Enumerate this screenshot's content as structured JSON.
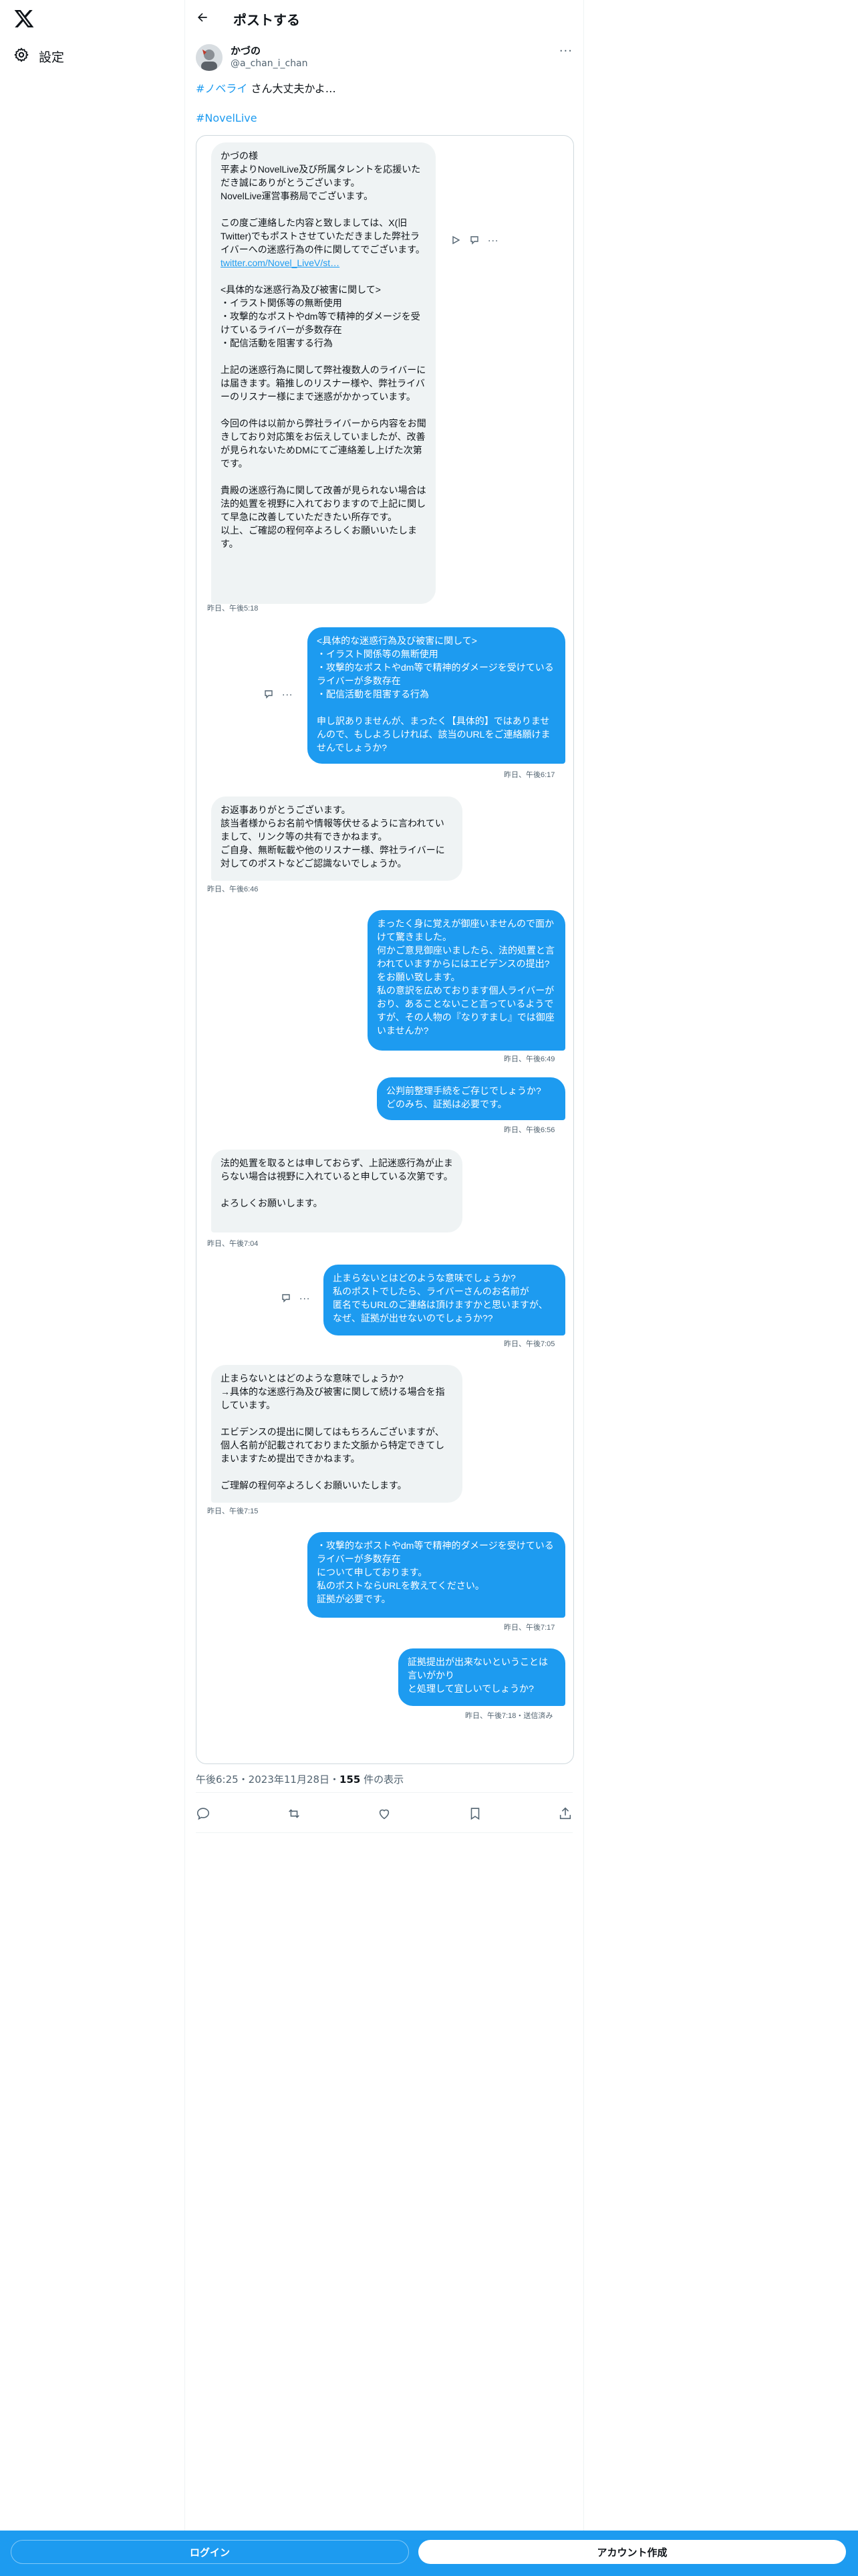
{
  "nav": {
    "settings_label": "設定"
  },
  "header": {
    "title": "ポストする"
  },
  "author": {
    "name": "かづの",
    "handle": "@a_chan_i_chan"
  },
  "tweet": {
    "hashtag1": "#ノベライ",
    "text_after_hashtag": " さん大丈夫かよ…",
    "hashtag2": "#NovelLive"
  },
  "dm": {
    "m1": "かづの様\n平素よりNovelLive及び所属タレントを応援いただき誠にありがとうございます。\nNovelLive運営事務局でございます。\n\nこの度ご連絡した内容と致しましては、X(旧Twitter)でもポストさせていただきました弊社ライバーへの迷惑行為の件に関してでございます。",
    "m1_link": "twitter.com/Novel_LiveV/st…",
    "m1_rest": "\n<具体的な迷惑行為及び被害に関して>\n・イラスト関係等の無断使用\n・攻撃的なポストやdm等で精神的ダメージを受けているライバーが多数存在\n・配信活動を阻害する行為\n\n上記の迷惑行為に関して弊社複数人のライバーには届きます。箱推しのリスナー様や、弊社ライバーのリスナー様にまで迷惑がかかっています。\n\n今回の件は以前から弊社ライバーから内容をお聞きしており対応策をお伝えしていましたが、改善が見られないためDMにてご連絡差し上げた次第です。\n\n貴殿の迷惑行為に関して改善が見られない場合は法的処置を視野に入れておりますので上記に関して早急に改善していただきたい所存です。\n以上、ご確認の程何卒よろしくお願いいたします。",
    "t1": "昨日、午後5:18",
    "m2": "<具体的な迷惑行為及び被害に関して>\n・イラスト関係等の無断使用\n・攻撃的なポストやdm等で精神的ダメージを受けているライバーが多数存在\n・配信活動を阻害する行為\n\n申し訳ありませんが、まったく【具体的】ではありませんので、もしよろしければ、該当のURLをご連絡願けませんでしょうか?",
    "t2": "昨日、午後6:17",
    "m3": "お返事ありがとうございます。\n該当者様からお名前や情報等伏せるように言われていまして、リンク等の共有できかねます。\nご自身、無断転載や他のリスナー様、弊社ライバーに対してのポストなどご認識ないでしょうか。",
    "t3": "昨日、午後6:46",
    "m4": "まったく身に覚えが御座いませんので面かけて驚きました。\n何かご意見御座いましたら、法的処置と言われていますからにはエビデンスの提出?をお願い致します。\n私の意訳を広めております個人ライバーがおり、あることないこと言っているようですが、その人物の『なりすまし』では御座いませんか?",
    "t4": "昨日、午後6:49",
    "m5": "公判前整理手続をご存じでしょうか?\nどのみち、証拠は必要です。",
    "t5": "昨日、午後6:56",
    "m6": "法的処置を取るとは申しておらず、上記迷惑行為が止まらない場合は視野に入れていると申している次第です。\n\nよろしくお願いします。",
    "t6": "昨日、午後7:04",
    "m7": "止まらないとはどのような意味でしょうか?\n私のポストでしたら、ライバーさんのお名前が\n匿名でもURLのご連絡は頂けますかと思いますが、なぜ、証拠が出せないのでしょうか??",
    "t7": "昨日、午後7:05",
    "m8": "止まらないとはどのような意味でしょうか?\n→具体的な迷惑行為及び被害に関して続ける場合を指しています。\n\nエビデンスの提出に関してはもちろんございますが、個人名前が記載されておりまた文脈から特定できてしまいますため提出できかねます。\n\nご理解の程何卒よろしくお願いいたします。",
    "t8": "昨日、午後7:15",
    "m9": "・攻撃的なポストやdm等で精神的ダメージを受けているライバーが多数存在\nについて申しております。\n私のポストならURLを教えてください。\n証拠が必要です。",
    "t9": "昨日、午後7:17",
    "m10": "証拠提出が出来ないということは言いがかり\nと処理して宜しいでしょうか?",
    "t10": "昨日、午後7:18・送信済み"
  },
  "meta": {
    "time": "午後6:25・2023年11月28日・",
    "views_count": "155",
    "views_label": " 件の表示"
  },
  "bottom": {
    "login": "ログイン",
    "signup": "アカウント作成"
  },
  "colors": {
    "accent": "#1d9bf0",
    "bubble_in": "#eff3f4",
    "text": "#0f1419",
    "muted": "#536471"
  }
}
